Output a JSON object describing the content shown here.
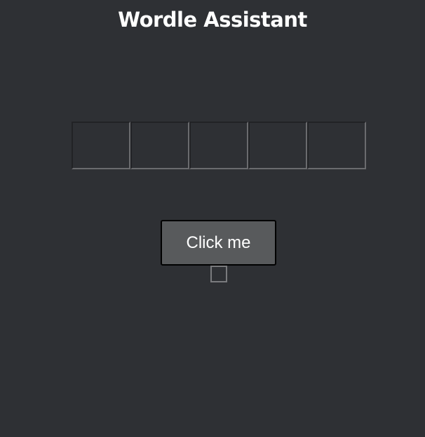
{
  "app": {
    "title": "Wordle Assistant"
  },
  "letter_row": {
    "boxes": [
      "",
      "",
      "",
      "",
      ""
    ]
  },
  "action": {
    "button_label": "Click me"
  },
  "option": {
    "checked": false
  },
  "colors": {
    "background": "#2e3034",
    "button": "#585a5c",
    "text": "#ffffff"
  }
}
